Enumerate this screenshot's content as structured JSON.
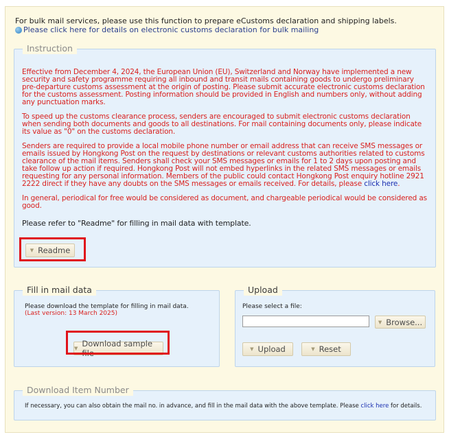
{
  "intro": {
    "text": "For bulk mail services, please use this function to prepare eCustoms declaration and shipping labels.",
    "link": "Please click here for details on electronic customs declaration for bulk mailing"
  },
  "instruction": {
    "legend": "Instruction",
    "paragraphs": [
      "Effective from December 4, 2024, the European Union (EU), Switzerland and Norway have implemented a new security and safety programme requiring all inbound and transit mails containing goods to undergo preliminary pre-departure customs assessment at the origin of posting. Please submit accurate electronic customs declaration for the customs assessment. Posting information should be provided in English and numbers only, without adding any punctuation marks.",
      "To speed up the customs clearance process, senders are encouraged to submit electronic customs declaration when sending both documents and goods to all destinations. For mail containing documents only, please indicate its value as \"0\" on the customs declaration.",
      "Senders are required to provide a local mobile phone number or email address that can receive SMS messages or emails issued by Hongkong Post on the request by destinations or relevant customs authorities related to customs clearance of the mail items. Senders shall check your SMS messages or emails for 1 to 2 days upon posting and take follow up action if required. Hongkong Post will not embed hyperlinks in the related SMS messages or emails requesting for any personal information. Members of the public could contact Hongkong Post enquiry hotline 2921 2222 direct if they have any doubts on the SMS messages or emails received. For details, please",
      "In general, periodical for free would be considered as document, and chargeable periodical would be considered as good."
    ],
    "click_here": "click here",
    "period": ".",
    "readme_note": "Please refer to \"Readme\" for filling in mail data with template.",
    "readme_button": "Readme"
  },
  "fill": {
    "legend": "Fill in mail data",
    "note": "Please download the template for filling in mail data.",
    "version": "(Last version: 13 March 2025)",
    "download_button": "Download sample file"
  },
  "upload": {
    "legend": "Upload",
    "select_label": "Please select a file:",
    "file_value": "",
    "browse_button": "Browse...",
    "upload_button": "Upload",
    "reset_button": "Reset"
  },
  "download_item": {
    "legend": "Download Item Number",
    "text_before": "If necessary, you can also obtain the mail no. in advance, and fill in the mail data with the above template. Please",
    "click_here": "click here",
    "text_after": "for details."
  },
  "colors": {
    "warning_text": "#d9211e",
    "highlight_box": "#e0121a",
    "panel_bg": "#e6f1fb",
    "page_bg": "#fdf9e3"
  },
  "icons": {
    "intro_link": "globe-icon",
    "button_marker": "chevron-down-icon"
  }
}
